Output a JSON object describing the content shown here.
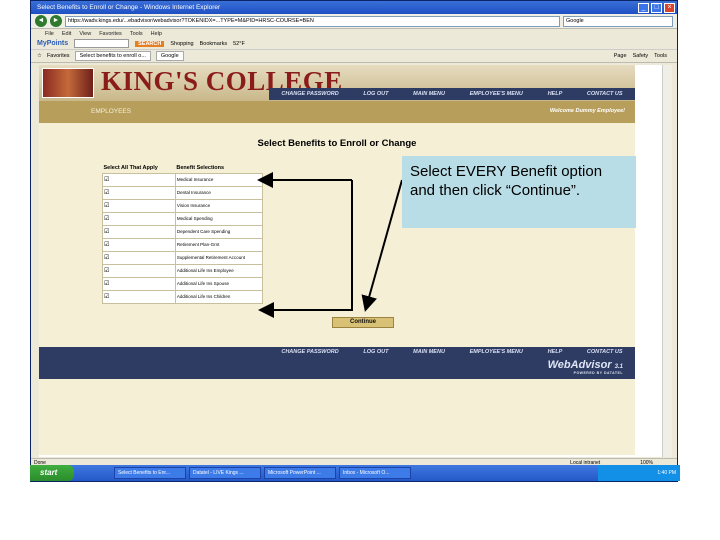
{
  "window": {
    "title": "Select Benefits to Enroll or Change - Windows Internet Explorer",
    "url": "https://wadv.kings.edu/...ebadvisor/webadvisor?TOKENIDX=...TYPE=M&PID=HRSC-COURSE=BEN",
    "search_placeholder": "Google"
  },
  "menu": [
    "File",
    "Edit",
    "View",
    "Favorites",
    "Tools",
    "Help"
  ],
  "toolbar": {
    "logo": "MyPoints",
    "search_button": "SEARCH",
    "items": [
      "Shopping",
      "Bookmarks",
      "52°F"
    ]
  },
  "favorites": {
    "label": "Favorites",
    "tabs": [
      "Select benefits to enroll o...",
      "Google"
    ],
    "right_tools": [
      "Page",
      "Safety",
      "Tools"
    ]
  },
  "site": {
    "college_name": "KING'S COLLEGE",
    "nav": [
      "CHANGE PASSWORD",
      "LOG OUT",
      "MAIN MENU",
      "EMPLOYEE'S MENU",
      "HELP",
      "CONTACT US"
    ],
    "section": "EMPLOYEES",
    "welcome": "Welcome Dummy Employee!",
    "page_title": "Select Benefits to Enroll or Change",
    "table": {
      "headers": [
        "Select All That Apply",
        "Benefit Selections"
      ],
      "rows": [
        {
          "check": "☑",
          "label": "Medical Insurance"
        },
        {
          "check": "☑",
          "label": "Dental Insurance"
        },
        {
          "check": "☑",
          "label": "Vision Insurance"
        },
        {
          "check": "☑",
          "label": "Medical Spending"
        },
        {
          "check": "☑",
          "label": "Dependent Care Spending"
        },
        {
          "check": "☑",
          "label": "Retirement Plan-Grnt"
        },
        {
          "check": "☑",
          "label": "Supplemental Retirement Account"
        },
        {
          "check": "☑",
          "label": "Additional Life Ins Employee"
        },
        {
          "check": "☑",
          "label": "Additional Life Ins Spouse"
        },
        {
          "check": "☑",
          "label": "Additional Life Ins Children"
        }
      ]
    },
    "continue_label": "Continue",
    "footer_nav": [
      "CHANGE PASSWORD",
      "LOG OUT",
      "MAIN MENU",
      "EMPLOYEE'S MENU",
      "HELP",
      "CONTACT US"
    ],
    "webadvisor": "WebAdvisor",
    "webadvisor_version": "3.1",
    "webadvisor_powered": "POWERED BY DATATEL"
  },
  "status": {
    "left": "Done",
    "zone": "Local intranet",
    "zoom": "100%"
  },
  "taskbar": {
    "start": "start",
    "tasks": [
      "Select Benefits to Enr...",
      "Datatel - LIVE Kings ...",
      "Microsoft PowerPoint ...",
      "Inbox - Microsoft O..."
    ],
    "clock": "1:40 PM"
  },
  "callout": {
    "text": "Select EVERY Benefit option and then click “Continue”."
  },
  "colors": {
    "navy": "#2e3b63",
    "gold": "#b79f5b",
    "maroon": "#8b1c1c",
    "callout": "#b8dde6"
  }
}
